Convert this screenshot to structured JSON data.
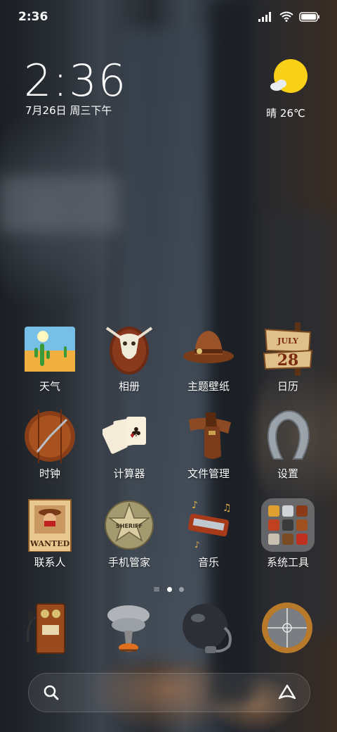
{
  "status_bar": {
    "time": "2:36",
    "signal": "signal-icon",
    "wifi": "wifi-icon",
    "battery": "battery-icon"
  },
  "clock_widget": {
    "time": "2:36",
    "date": "7月26日 周三下午"
  },
  "weather_widget": {
    "condition_icon": "sunny-icon",
    "text": "晴 26℃"
  },
  "apps": [
    {
      "label": "天气",
      "icon": "weather-app-icon"
    },
    {
      "label": "相册",
      "icon": "gallery-app-icon"
    },
    {
      "label": "主题壁纸",
      "icon": "themes-app-icon"
    },
    {
      "label": "日历",
      "icon": "calendar-app-icon",
      "month": "JULY",
      "day": "28"
    },
    {
      "label": "时钟",
      "icon": "clock-app-icon"
    },
    {
      "label": "计算器",
      "icon": "calculator-app-icon"
    },
    {
      "label": "文件管理",
      "icon": "file-manager-app-icon"
    },
    {
      "label": "设置",
      "icon": "settings-app-icon"
    },
    {
      "label": "联系人",
      "icon": "contacts-app-icon",
      "badge_text": "WANTED"
    },
    {
      "label": "手机管家",
      "icon": "security-app-icon",
      "badge_text": "SHERIFF"
    },
    {
      "label": "音乐",
      "icon": "music-app-icon"
    },
    {
      "label": "系统工具",
      "icon": "system-tools-folder-icon"
    }
  ],
  "page_indicator": {
    "pages": 2,
    "current": 1
  },
  "dock": [
    {
      "icon": "phone-app-icon"
    },
    {
      "icon": "messages-app-icon"
    },
    {
      "icon": "browser-app-icon"
    },
    {
      "icon": "camera-app-icon"
    }
  ],
  "search_bar": {
    "left_icon": "search-icon",
    "right_icon": "assistant-icon"
  },
  "colors": {
    "sun": "#f9d018",
    "wood": "#8a4a22",
    "leather": "#8b4a24"
  }
}
